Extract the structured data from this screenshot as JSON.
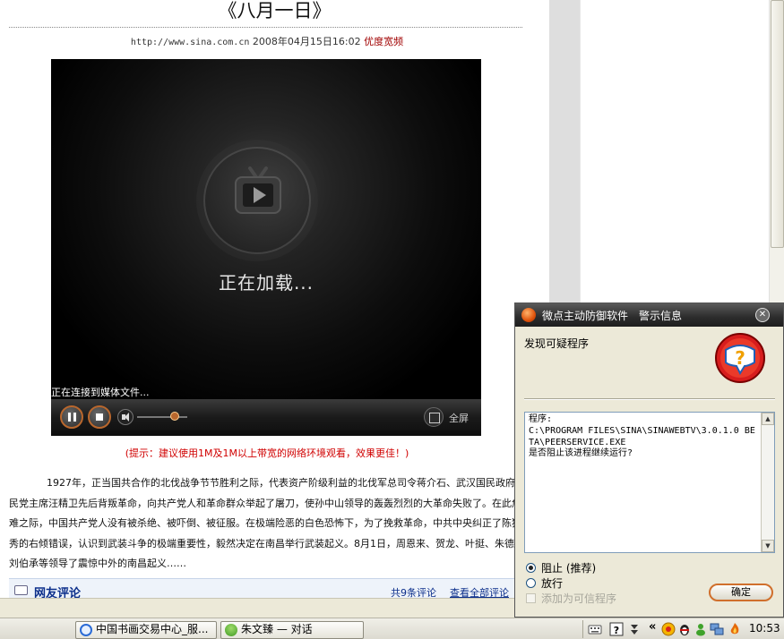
{
  "article": {
    "title": "《八月一日》",
    "url": "http://www.sina.com.cn",
    "datetime": "2008年04月15日16:02",
    "source_link": "优度宽频",
    "hint": "(提示：建议使用1M及1M以上带宽的网络环境观看，效果更佳！)",
    "body": "1927年，正当国共合作的北伐战争节节胜利之际，代表资产阶级利益的北伐军总司令蒋介石、武汉国民政府国民党主席汪精卫先后背叛革命，向共产党人和革命群众举起了屠刀，使孙中山领导的轰轰烈烈的大革命失败了。在此危难之际，中国共产党人没有被杀绝、被吓倒、被征服。在极端险恶的白色恐怖下，为了挽救革命，中共中央纠正了陈独秀的右倾错误，认识到武装斗争的极端重要性，毅然决定在南昌举行武装起义。8月1日，周恩来、贺龙、叶挺、朱德、刘伯承等领导了震惊中外的南昌起义……"
  },
  "player": {
    "loading_text": "正在加载...",
    "status_text": "正在连接到媒体文件...",
    "fullscreen_label": "全屏",
    "volume_level": 0.75,
    "accent_color": "#b9672d"
  },
  "comments": {
    "title": "网友评论",
    "count": "共9条评论",
    "view_all": "查看全部评论"
  },
  "popup": {
    "title": "微点主动防御软件　警示信息",
    "heading": "发现可疑程序",
    "details": "程序:\nC:\\PROGRAM FILES\\SINA\\SINAWEBTV\\3.0.1.0 BETA\\PEERSERVICE.EXE\n是否阻止该进程继续运行?",
    "option_block": "阻止 (推荐)",
    "option_allow": "放行",
    "trust_label": "添加为可信程序",
    "ok_label": "确定",
    "selected": "block"
  },
  "taskbar": {
    "items": [
      "中国书画交易中心_服...",
      "朱文臻 — 对话"
    ],
    "tray_chevron": "«",
    "clock": "10:53"
  }
}
